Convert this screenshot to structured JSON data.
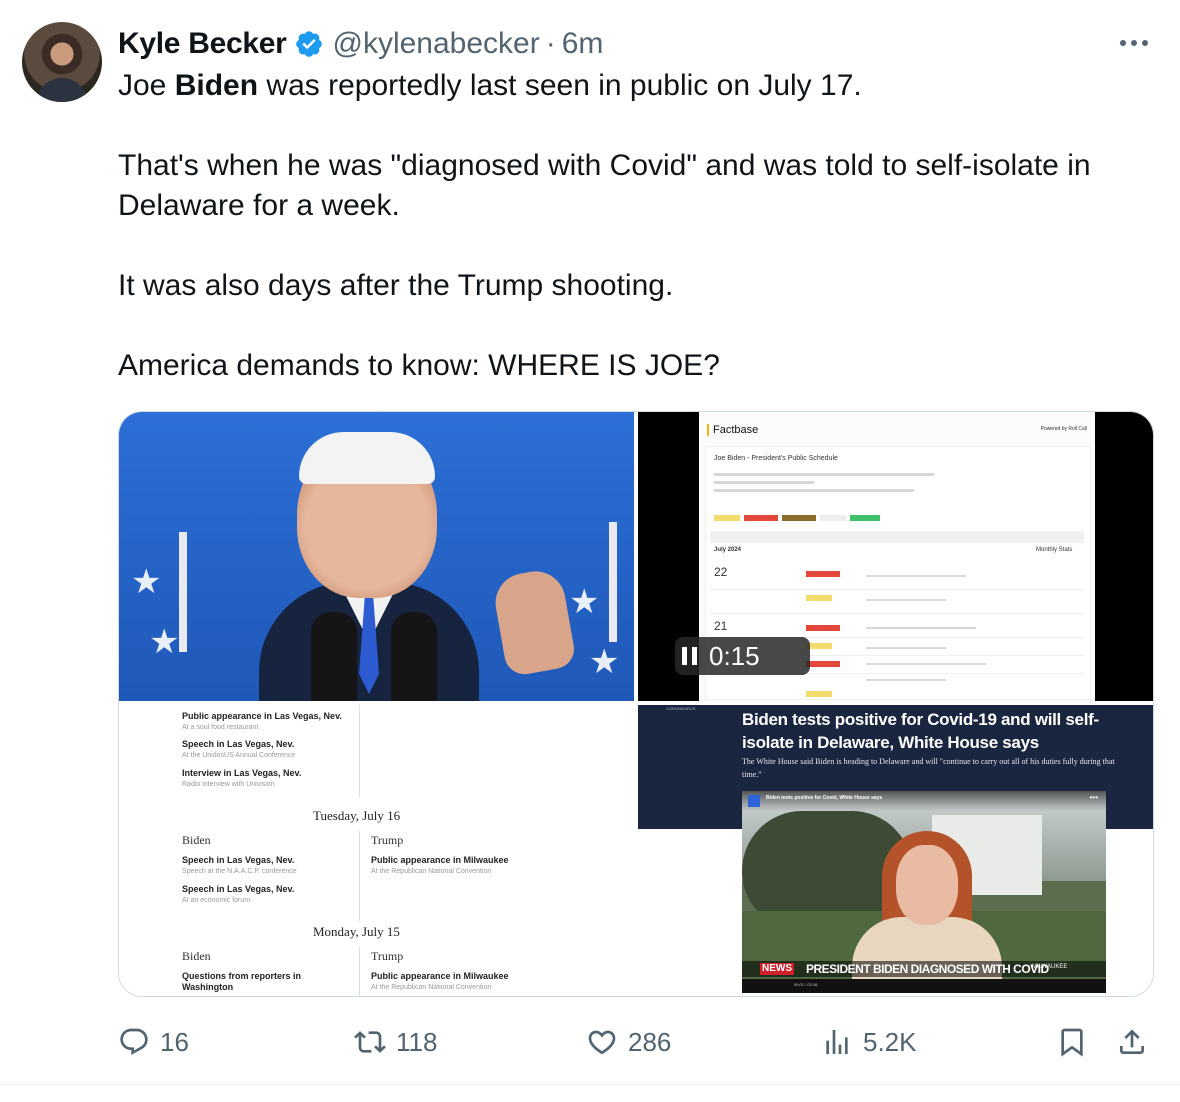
{
  "tweet": {
    "author_name": "Kyle Becker",
    "handle": "@kylenabecker",
    "separator": "·",
    "time": "6m",
    "verified": true,
    "text_line1_prefix": "Joe ",
    "text_line1_bold": "Biden",
    "text_line1_suffix": " was reportedly last seen in public on July 17.",
    "paragraph2": "That's when he was \"diagnosed with Covid\" and was told to self-isolate in Delaware for a week.",
    "paragraph3": "It was also days after the Trump shooting.",
    "paragraph4": "America demands to know: WHERE IS JOE?"
  },
  "media": {
    "video": {
      "duration_label": "0:15",
      "site_name": "Factbase",
      "site_credit": "Powered by Roll Call",
      "page_title": "Joe Biden - President's Public Schedule",
      "section_month": "July 2024",
      "monthly_stats": "Monthly Stats",
      "date_22": "22",
      "date_21": "21"
    },
    "schedule": {
      "items_top": [
        {
          "title": "Public appearance in Las Vegas, Nev.",
          "sub": "At a soul food restaurant"
        },
        {
          "title": "Speech in Las Vegas, Nev.",
          "sub": "At the UnidosUS Annual Conference"
        },
        {
          "title": "Interview in Las Vegas, Nev.",
          "sub": "Radio interview with Univision"
        }
      ],
      "day1": "Tuesday, July 16",
      "col_biden": "Biden",
      "col_trump": "Trump",
      "day1_biden": [
        {
          "title": "Speech in Las Vegas, Nev.",
          "sub": "Speech at the N.A.A.C.P. conference"
        },
        {
          "title": "Speech in Las Vegas, Nev.",
          "sub": "At an economic forum"
        }
      ],
      "day1_trump": [
        {
          "title": "Public appearance in Milwaukee",
          "sub": "At the Republican National Convention"
        }
      ],
      "day2": "Monday, July 15",
      "day2_biden": [
        {
          "title": "Questions from reporters in Washington",
          "sub": ""
        }
      ],
      "day2_trump": [
        {
          "title": "Public appearance in Milwaukee",
          "sub": "At the Republican National Convention"
        }
      ]
    },
    "news": {
      "category": "CORONAVIRUS",
      "headline": "Biden tests positive for Covid-19 and will self-isolate in Delaware, White House says",
      "subhead": "The White House said Biden is heading to Delaware and will \"continue to carry out all of his duties fully during that time.\"",
      "video_title": "Biden tests positive for Covid, White House says",
      "breaking_label": "NEWS",
      "ticker": "PRESIDENT BIDEN DIAGNOSED WITH COVID",
      "ticker_location": "MILWAUKEE",
      "player_time": "00:01 / 02:16"
    }
  },
  "actions": {
    "replies": "16",
    "reposts": "118",
    "likes": "286",
    "views": "5.2K"
  },
  "colors": {
    "text": "#0f1419",
    "secondary": "#536471",
    "verified_blue": "#1d9bf0",
    "border": "#cfd9de"
  }
}
